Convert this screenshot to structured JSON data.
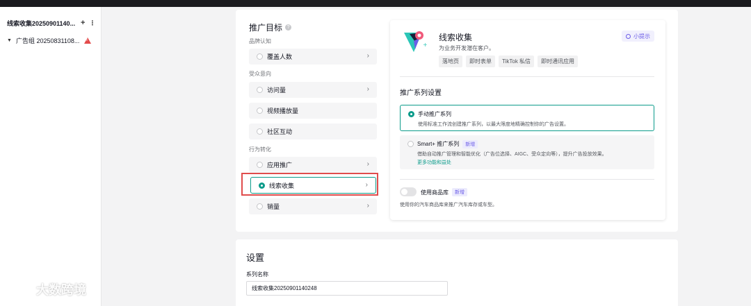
{
  "sidebar": {
    "campaign": "线索收集20250901140...",
    "add": "+",
    "more": "⋮",
    "adgroup": "广告组 20250831108..."
  },
  "objective": {
    "title": "推广目标",
    "groups": {
      "brand": "品牌认知",
      "consideration": "受众意向",
      "conversion": "行为转化"
    },
    "options": {
      "reach": "覆盖人数",
      "traffic": "访问量",
      "video_views": "视频播放量",
      "engagement": "社区互动",
      "app_promotion": "应用推广",
      "lead_generation": "线索收集",
      "sales": "销量"
    }
  },
  "detail": {
    "name": "线索收集",
    "description": "为业务开发潜在客户。",
    "tags": [
      "落地页",
      "即时表单",
      "TikTok 私信",
      "即时通讯应用"
    ],
    "tips": "小提示",
    "series_title": "推广系列设置",
    "manual_name": "手动推广系列",
    "manual_desc": "使用标准工作流创建推广系列，以最大限度地精确控制你的广告设置。",
    "smart_name": "Smart+ 推广系列",
    "new_badge": "新增",
    "smart_desc": "借助自动推广管理和智能优化（广告位选择、AIGC、受众定向等），提升广告投放效果。",
    "smart_link": "更多功能和益处",
    "catalog_label": "使用商品库",
    "catalog_desc": "使用你的汽车商品库来推广汽车库存或车型。"
  },
  "settings": {
    "title": "设置",
    "field_label": "系列名称",
    "field_value": "线索收集20250901140248"
  },
  "watermark": "大数跨境",
  "colors": {
    "accent": "#0b9b8a",
    "highlight": "#e04c4c",
    "badge": "#6b5ce7"
  }
}
